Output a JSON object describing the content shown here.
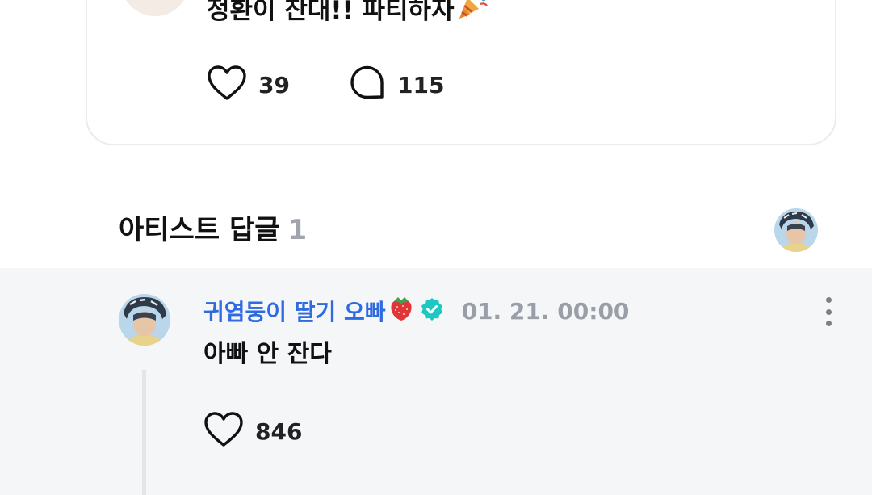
{
  "post": {
    "text": "정환이 잔대!! 파티하자",
    "emoji_icon": "party-popper-icon",
    "like_count": "39",
    "comment_count": "115"
  },
  "artist_replies": {
    "title": "아티스트 답글",
    "count": "1"
  },
  "reply": {
    "author": "귀염둥이 딸기 오빠",
    "author_emoji_icon": "strawberry-icon",
    "verified_icon": "verified-badge-icon",
    "date": "01. 21. 00:00",
    "text": "아빠 안 잔다",
    "like_count": "846"
  },
  "colors": {
    "author_blue": "#2f6be0",
    "verified_teal": "#1fc7c2",
    "reply_bg": "#f5f6f8",
    "muted_gray": "#9a9ea6"
  }
}
